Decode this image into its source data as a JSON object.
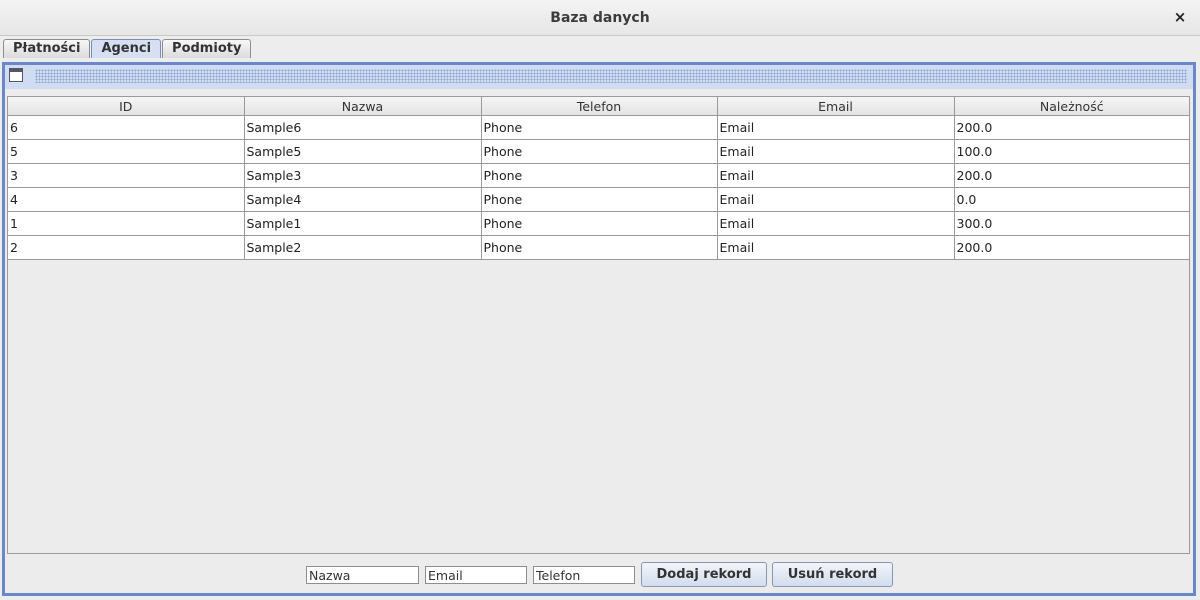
{
  "window": {
    "title": "Baza danych",
    "close_label": "×"
  },
  "tabs": [
    {
      "label": "Płatności",
      "active": false
    },
    {
      "label": "Agenci",
      "active": true
    },
    {
      "label": "Podmioty",
      "active": false
    }
  ],
  "table": {
    "columns": [
      "ID",
      "Nazwa",
      "Telefon",
      "Email",
      "Należność"
    ],
    "rows": [
      [
        "6",
        "Sample6",
        "Phone",
        "Email",
        "200.0"
      ],
      [
        "5",
        "Sample5",
        "Phone",
        "Email",
        "100.0"
      ],
      [
        "3",
        "Sample3",
        "Phone",
        "Email",
        "200.0"
      ],
      [
        "4",
        "Sample4",
        "Phone",
        "Email",
        "0.0"
      ],
      [
        "1",
        "Sample1",
        "Phone",
        "Email",
        "300.0"
      ],
      [
        "2",
        "Sample2",
        "Phone",
        "Email",
        "200.0"
      ]
    ]
  },
  "form": {
    "name_value": "Nazwa",
    "email_value": "Email",
    "phone_value": "Telefon",
    "add_label": "Dodaj rekord",
    "remove_label": "Usuń rekord"
  },
  "colors": {
    "accent": "#6a88c9",
    "active_tab": "#d6e0f2"
  },
  "icons": {
    "panel_icon": "window-icon",
    "close_icon": "close-icon"
  }
}
